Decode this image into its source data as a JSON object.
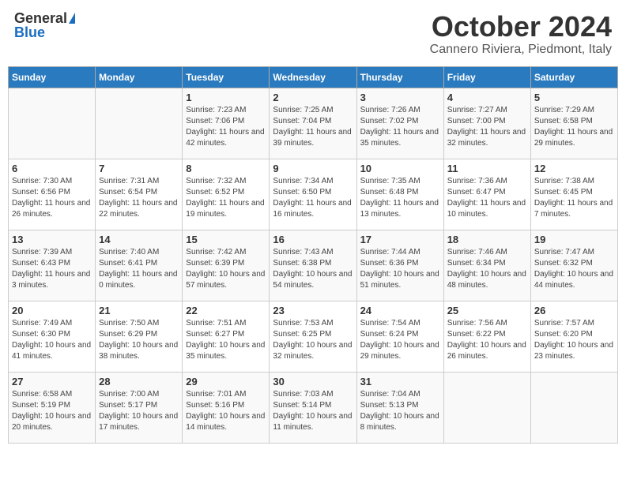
{
  "header": {
    "logo_general": "General",
    "logo_blue": "Blue",
    "month_title": "October 2024",
    "location": "Cannero Riviera, Piedmont, Italy"
  },
  "weekdays": [
    "Sunday",
    "Monday",
    "Tuesday",
    "Wednesday",
    "Thursday",
    "Friday",
    "Saturday"
  ],
  "weeks": [
    [
      {
        "date": "",
        "info": ""
      },
      {
        "date": "",
        "info": ""
      },
      {
        "date": "1",
        "info": "Sunrise: 7:23 AM\nSunset: 7:06 PM\nDaylight: 11 hours and 42 minutes."
      },
      {
        "date": "2",
        "info": "Sunrise: 7:25 AM\nSunset: 7:04 PM\nDaylight: 11 hours and 39 minutes."
      },
      {
        "date": "3",
        "info": "Sunrise: 7:26 AM\nSunset: 7:02 PM\nDaylight: 11 hours and 35 minutes."
      },
      {
        "date": "4",
        "info": "Sunrise: 7:27 AM\nSunset: 7:00 PM\nDaylight: 11 hours and 32 minutes."
      },
      {
        "date": "5",
        "info": "Sunrise: 7:29 AM\nSunset: 6:58 PM\nDaylight: 11 hours and 29 minutes."
      }
    ],
    [
      {
        "date": "6",
        "info": "Sunrise: 7:30 AM\nSunset: 6:56 PM\nDaylight: 11 hours and 26 minutes."
      },
      {
        "date": "7",
        "info": "Sunrise: 7:31 AM\nSunset: 6:54 PM\nDaylight: 11 hours and 22 minutes."
      },
      {
        "date": "8",
        "info": "Sunrise: 7:32 AM\nSunset: 6:52 PM\nDaylight: 11 hours and 19 minutes."
      },
      {
        "date": "9",
        "info": "Sunrise: 7:34 AM\nSunset: 6:50 PM\nDaylight: 11 hours and 16 minutes."
      },
      {
        "date": "10",
        "info": "Sunrise: 7:35 AM\nSunset: 6:48 PM\nDaylight: 11 hours and 13 minutes."
      },
      {
        "date": "11",
        "info": "Sunrise: 7:36 AM\nSunset: 6:47 PM\nDaylight: 11 hours and 10 minutes."
      },
      {
        "date": "12",
        "info": "Sunrise: 7:38 AM\nSunset: 6:45 PM\nDaylight: 11 hours and 7 minutes."
      }
    ],
    [
      {
        "date": "13",
        "info": "Sunrise: 7:39 AM\nSunset: 6:43 PM\nDaylight: 11 hours and 3 minutes."
      },
      {
        "date": "14",
        "info": "Sunrise: 7:40 AM\nSunset: 6:41 PM\nDaylight: 11 hours and 0 minutes."
      },
      {
        "date": "15",
        "info": "Sunrise: 7:42 AM\nSunset: 6:39 PM\nDaylight: 10 hours and 57 minutes."
      },
      {
        "date": "16",
        "info": "Sunrise: 7:43 AM\nSunset: 6:38 PM\nDaylight: 10 hours and 54 minutes."
      },
      {
        "date": "17",
        "info": "Sunrise: 7:44 AM\nSunset: 6:36 PM\nDaylight: 10 hours and 51 minutes."
      },
      {
        "date": "18",
        "info": "Sunrise: 7:46 AM\nSunset: 6:34 PM\nDaylight: 10 hours and 48 minutes."
      },
      {
        "date": "19",
        "info": "Sunrise: 7:47 AM\nSunset: 6:32 PM\nDaylight: 10 hours and 44 minutes."
      }
    ],
    [
      {
        "date": "20",
        "info": "Sunrise: 7:49 AM\nSunset: 6:30 PM\nDaylight: 10 hours and 41 minutes."
      },
      {
        "date": "21",
        "info": "Sunrise: 7:50 AM\nSunset: 6:29 PM\nDaylight: 10 hours and 38 minutes."
      },
      {
        "date": "22",
        "info": "Sunrise: 7:51 AM\nSunset: 6:27 PM\nDaylight: 10 hours and 35 minutes."
      },
      {
        "date": "23",
        "info": "Sunrise: 7:53 AM\nSunset: 6:25 PM\nDaylight: 10 hours and 32 minutes."
      },
      {
        "date": "24",
        "info": "Sunrise: 7:54 AM\nSunset: 6:24 PM\nDaylight: 10 hours and 29 minutes."
      },
      {
        "date": "25",
        "info": "Sunrise: 7:56 AM\nSunset: 6:22 PM\nDaylight: 10 hours and 26 minutes."
      },
      {
        "date": "26",
        "info": "Sunrise: 7:57 AM\nSunset: 6:20 PM\nDaylight: 10 hours and 23 minutes."
      }
    ],
    [
      {
        "date": "27",
        "info": "Sunrise: 6:58 AM\nSunset: 5:19 PM\nDaylight: 10 hours and 20 minutes."
      },
      {
        "date": "28",
        "info": "Sunrise: 7:00 AM\nSunset: 5:17 PM\nDaylight: 10 hours and 17 minutes."
      },
      {
        "date": "29",
        "info": "Sunrise: 7:01 AM\nSunset: 5:16 PM\nDaylight: 10 hours and 14 minutes."
      },
      {
        "date": "30",
        "info": "Sunrise: 7:03 AM\nSunset: 5:14 PM\nDaylight: 10 hours and 11 minutes."
      },
      {
        "date": "31",
        "info": "Sunrise: 7:04 AM\nSunset: 5:13 PM\nDaylight: 10 hours and 8 minutes."
      },
      {
        "date": "",
        "info": ""
      },
      {
        "date": "",
        "info": ""
      }
    ]
  ]
}
